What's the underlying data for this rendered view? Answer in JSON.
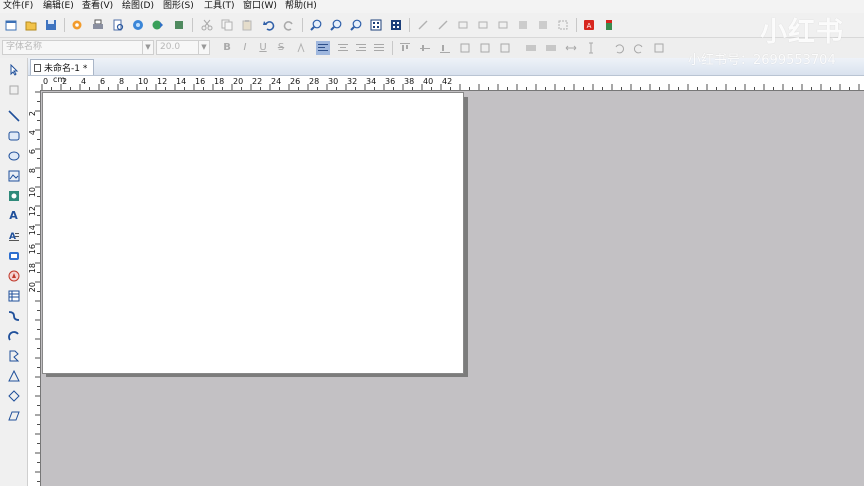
{
  "menu": [
    "文件(F)",
    "编辑(E)",
    "查看(V)",
    "绘图(D)",
    "图形(S)",
    "工具(T)",
    "窗口(W)",
    "帮助(H)"
  ],
  "format_bar": {
    "font_placeholder": "字体名称",
    "font_size": "20.0",
    "bold": "B",
    "italic": "I",
    "underline": "U",
    "strike": "S"
  },
  "document_tab": {
    "title": "未命名-1 *"
  },
  "ruler": {
    "unit": "cm",
    "h_labels": [
      "0",
      "2",
      "4",
      "6",
      "8",
      "10",
      "12",
      "14",
      "16",
      "18",
      "20",
      "22",
      "24",
      "26",
      "28",
      "30",
      "32",
      "34",
      "36",
      "38",
      "40",
      "42"
    ],
    "v_labels": [
      "2",
      "4",
      "6",
      "8",
      "10",
      "12",
      "14",
      "16",
      "18",
      "20"
    ]
  },
  "watermark": {
    "logo": "小红书",
    "id_text": "小红书号：2699553704"
  },
  "icons": {
    "toolbar": [
      "new-icon",
      "open-icon",
      "save-icon",
      "settings-icon",
      "print-icon",
      "print-preview-icon",
      "database-icon",
      "export-icon",
      "stop-icon",
      "cut-icon",
      "copy-icon",
      "paste-icon",
      "undo-icon",
      "redo-icon",
      "zoom-in-icon",
      "zoom-out-icon",
      "zoom-fit-icon",
      "zoom-grid-icon",
      "zoom-page-icon",
      "pdf-icon",
      "battery-icon"
    ],
    "tools": [
      "select-icon",
      "pan-icon",
      "line-icon",
      "rectangle-icon",
      "ellipse-icon",
      "image-icon",
      "picture-icon",
      "text-icon",
      "paragraph-icon",
      "barcode-icon",
      "shape-icon",
      "table-icon",
      "curve-icon",
      "arc-icon",
      "polyline-icon",
      "triangle-icon",
      "diamond-icon",
      "parallelogram-icon"
    ]
  },
  "colors": {
    "workspace": "#c3c1c4",
    "tool_blue": "#1f4f9a",
    "pdf_red": "#d7261e"
  }
}
